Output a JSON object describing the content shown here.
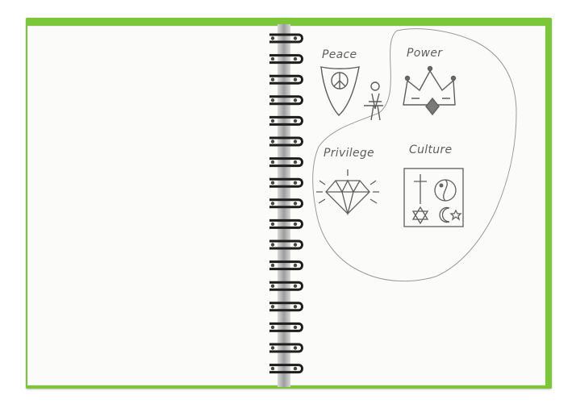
{
  "photo": {
    "subject": "spiral-notebook-sketch",
    "cover_color": "#7cc63a",
    "paper_color": "#fbfbfa",
    "pencil_color": "#5e5e5e",
    "spiral_color": "#1d1d1d"
  },
  "sketch": {
    "labels": {
      "peace": "Peace",
      "power": "Power",
      "privilege": "Privilege",
      "culture": "Culture"
    },
    "icons": [
      "peace-sign-icon",
      "crown-icon",
      "diamond-icon",
      "religion-symbols-icon"
    ]
  }
}
